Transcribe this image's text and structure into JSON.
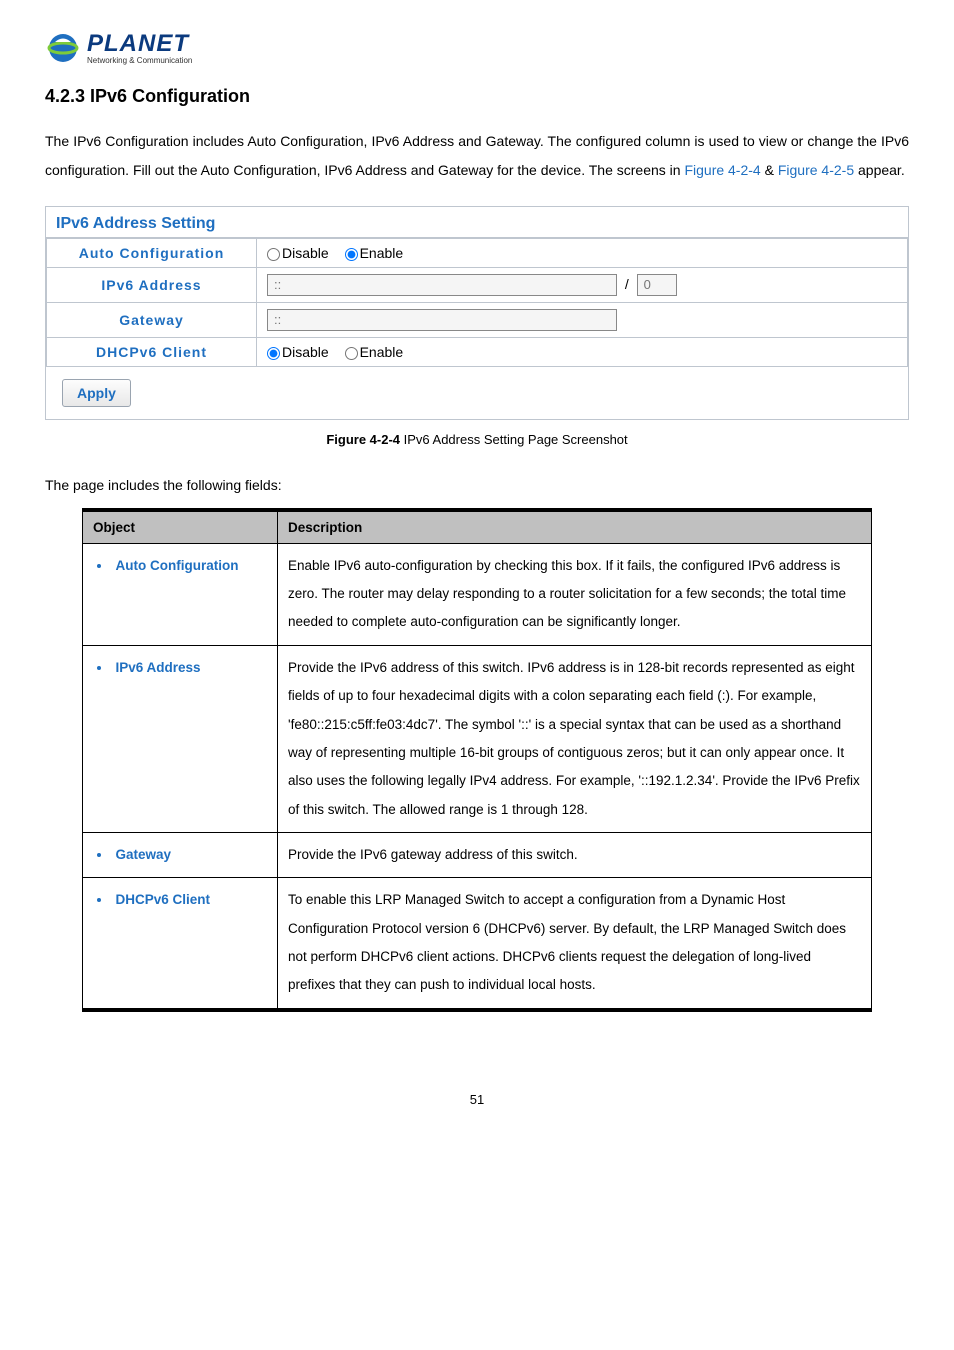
{
  "header": {
    "logo_name": "PLANET",
    "logo_tagline": "Networking & Communication"
  },
  "section": {
    "heading": "4.2.3 IPv6 Configuration",
    "intro_prefix": "The IPv6 Configuration includes Auto Configuration, IPv6 Address and Gateway. The configured column is used to view or change the IPv6 configuration. Fill out the Auto Configuration, IPv6 Address and Gateway for the device. The screens in ",
    "fig_link1": "Figure 4-2-4",
    "intro_amp": " & ",
    "fig_link2": "Figure 4-2-5",
    "intro_suffix": " appear."
  },
  "panel": {
    "title": "IPv6 Address Setting",
    "rows": {
      "auto_config_label": "Auto Configuration",
      "auto_config_disable": "Disable",
      "auto_config_enable": "Enable",
      "ipv6_addr_label": "IPv6 Address",
      "ipv6_addr_placeholder": "::",
      "ipv6_prefix_placeholder": "0",
      "gateway_label": "Gateway",
      "gateway_placeholder": "::",
      "dhcpv6_label": "DHCPv6 Client",
      "dhcpv6_disable": "Disable",
      "dhcpv6_enable": "Enable"
    },
    "apply_label": "Apply"
  },
  "figure_caption": {
    "bold": "Figure 4-2-4 ",
    "rest": "IPv6 Address Setting Page Screenshot"
  },
  "fields_intro": "The page includes the following fields:",
  "doc_table": {
    "header_object": "Object",
    "header_description": "Description",
    "rows": [
      {
        "object": "Auto Configuration",
        "description": "Enable IPv6 auto-configuration by checking this box.\nIf it fails, the configured IPv6 address is zero. The router may delay responding to a router solicitation for a few seconds; the total time needed to complete auto-configuration can be significantly longer."
      },
      {
        "object": "IPv6 Address",
        "description": "Provide the IPv6 address of this switch.\nIPv6 address is in 128-bit records represented as eight fields of up to four hexadecimal digits with a colon separating each field (:). For example, 'fe80::215:c5ff:fe03:4dc7'.\nThe symbol '::' is a special syntax that can be used as a shorthand way of representing multiple 16-bit groups of contiguous zeros; but it can only appear once. It also uses the following legally IPv4 address. For example, '::192.1.2.34'.\nProvide the IPv6 Prefix of this switch. The allowed range is 1 through 128."
      },
      {
        "object": "Gateway",
        "description": "Provide the IPv6 gateway address of this switch."
      },
      {
        "object": "DHCPv6 Client",
        "description": "To enable this LRP Managed Switch to accept a configuration from a Dynamic Host Configuration Protocol version 6 (DHCPv6) server. By default, the LRP Managed Switch does not perform DHCPv6 client actions. DHCPv6 clients request the delegation of long-lived prefixes that they can push to individual local hosts."
      }
    ]
  },
  "page_number": "51"
}
